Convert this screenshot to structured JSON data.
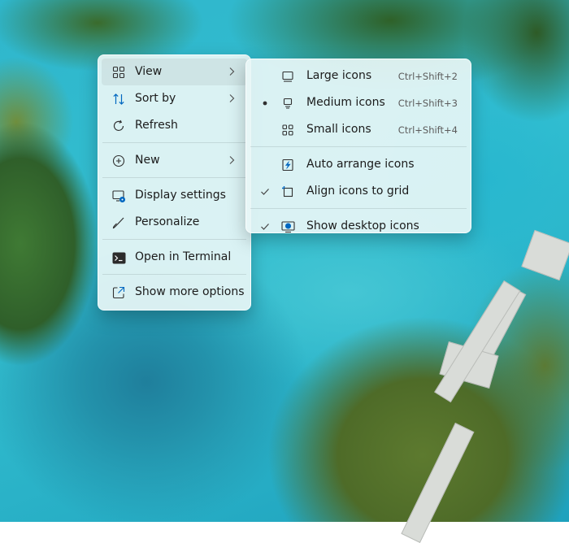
{
  "context_menu": {
    "items": [
      {
        "label": "View",
        "icon": "grid-icon"
      },
      {
        "label": "Sort by",
        "icon": "sort-arrows-icon"
      },
      {
        "label": "Refresh",
        "icon": "refresh-icon"
      },
      {
        "label": "New",
        "icon": "plus-circle-icon"
      },
      {
        "label": "Display settings",
        "icon": "display-settings-icon"
      },
      {
        "label": "Personalize",
        "icon": "brush-icon"
      },
      {
        "label": "Open in Terminal",
        "icon": "terminal-icon"
      },
      {
        "label": "Show more options",
        "icon": "external-link-icon"
      }
    ]
  },
  "view_submenu": {
    "items": [
      {
        "label": "Large icons",
        "shortcut": "Ctrl+Shift+2",
        "icon": "large-icons-icon",
        "state": "none"
      },
      {
        "label": "Medium icons",
        "shortcut": "Ctrl+Shift+3",
        "icon": "medium-icons-icon",
        "state": "selected"
      },
      {
        "label": "Small icons",
        "shortcut": "Ctrl+Shift+4",
        "icon": "small-icons-icon",
        "state": "none"
      },
      {
        "label": "Auto arrange icons",
        "icon": "auto-arrange-icon",
        "state": "unchecked"
      },
      {
        "label": "Align icons to grid",
        "icon": "align-grid-icon",
        "state": "checked"
      },
      {
        "label": "Show desktop icons",
        "icon": "show-desktop-icon",
        "state": "checked"
      }
    ]
  },
  "colors": {
    "accent": "#0067c0",
    "menu_bg": "#e8f6f6",
    "text": "#1b1b1b"
  }
}
